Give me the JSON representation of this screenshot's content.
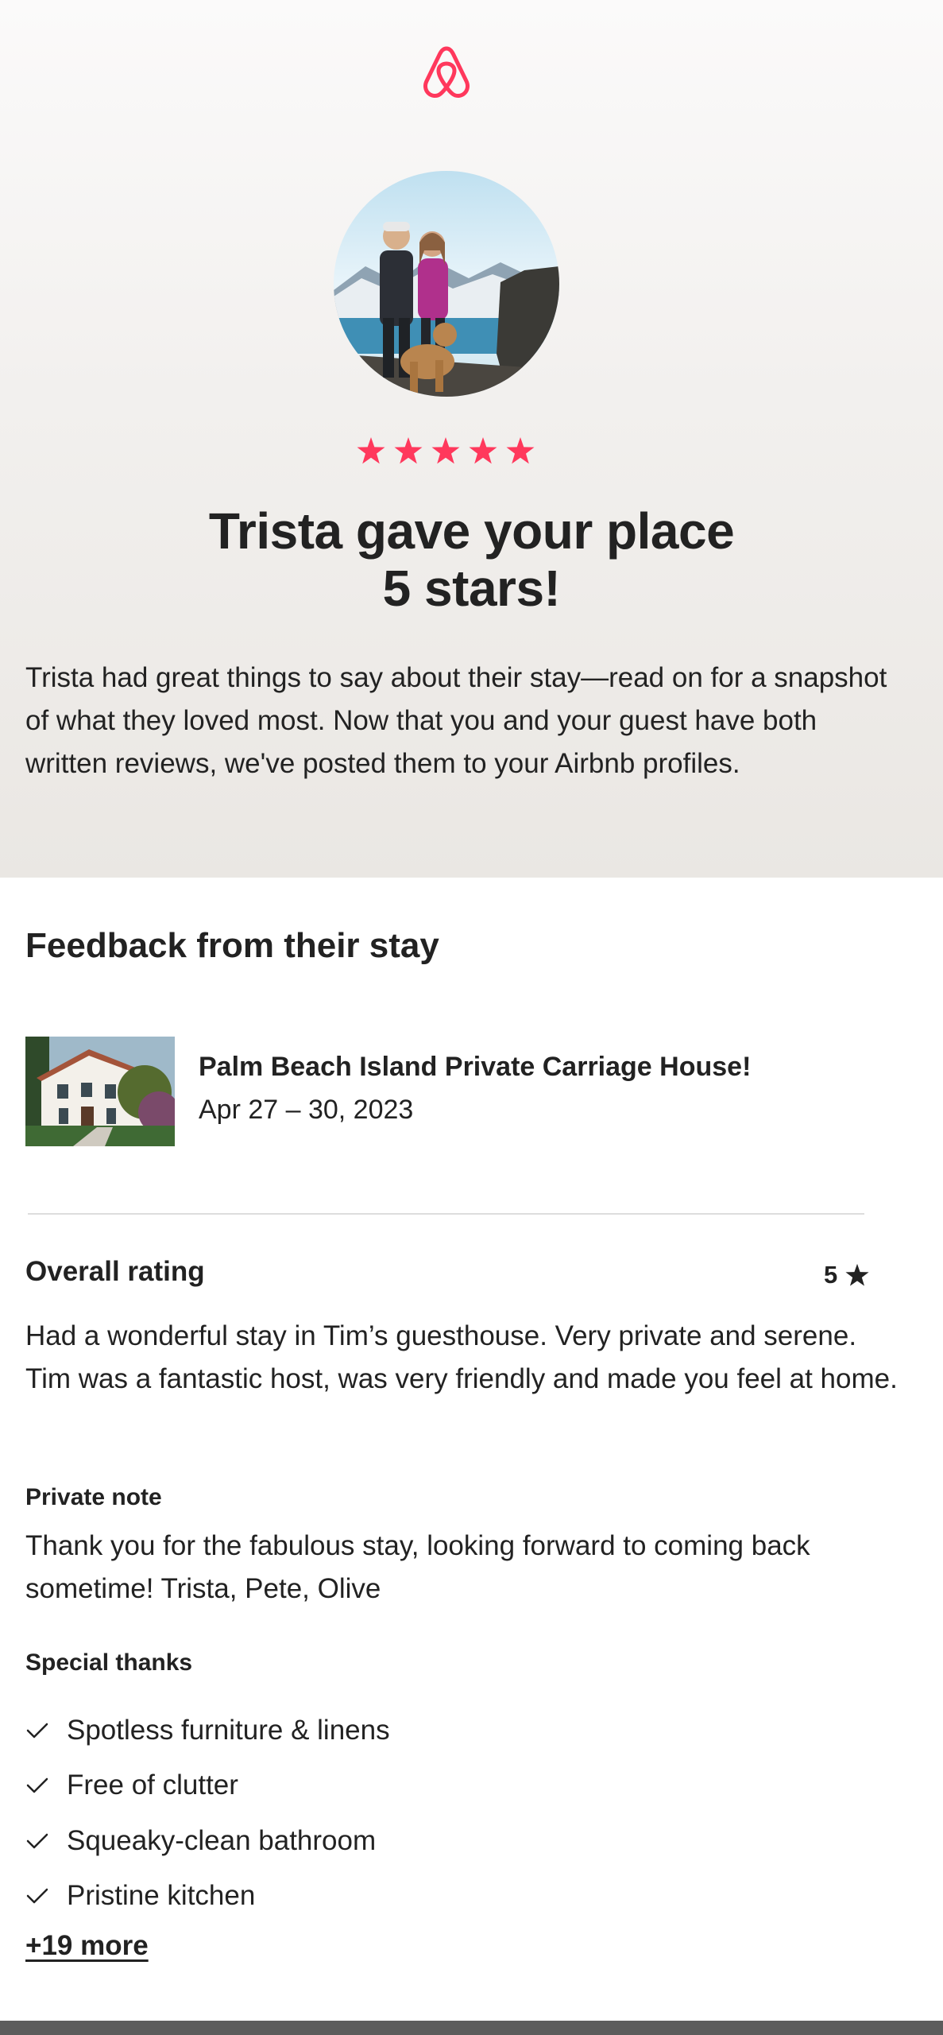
{
  "colors": {
    "brand": "#FF385C",
    "text": "#222222",
    "divider": "#DDDDDD"
  },
  "header": {
    "logo_icon": "airbnb-logo-icon",
    "avatar_alt": "Guest profile photo"
  },
  "rating_stars": 5,
  "hero": {
    "title_line1": "Trista gave your place",
    "title_line2": "5 stars!",
    "body": "Trista had great things to say about their stay—read on for a snapshot of what they loved most. Now that you and your guest have both written reviews, we've posted them to your Airbnb profiles."
  },
  "feedback": {
    "section_title": "Feedback from their stay",
    "listing": {
      "name": "Palm Beach Island Private Carriage House!",
      "dates": "Apr 27 – 30, 2023"
    },
    "overall": {
      "label": "Overall rating",
      "value": "5",
      "icon": "star-icon"
    },
    "review_text": "Had a wonderful stay in Tim’s guesthouse. Very private and serene. Tim was a fantastic host, was very friendly and made you feel at home.",
    "private_note": {
      "label": "Private note",
      "text": "Thank you for the fabulous stay, looking forward to coming back sometime! Trista, Pete, Olive"
    },
    "special_thanks": {
      "label": "Special thanks",
      "items": [
        "Spotless furniture & linens",
        "Free of clutter",
        "Squeaky-clean bathroom",
        "Pristine kitchen"
      ],
      "more_link": "+19 more"
    }
  }
}
